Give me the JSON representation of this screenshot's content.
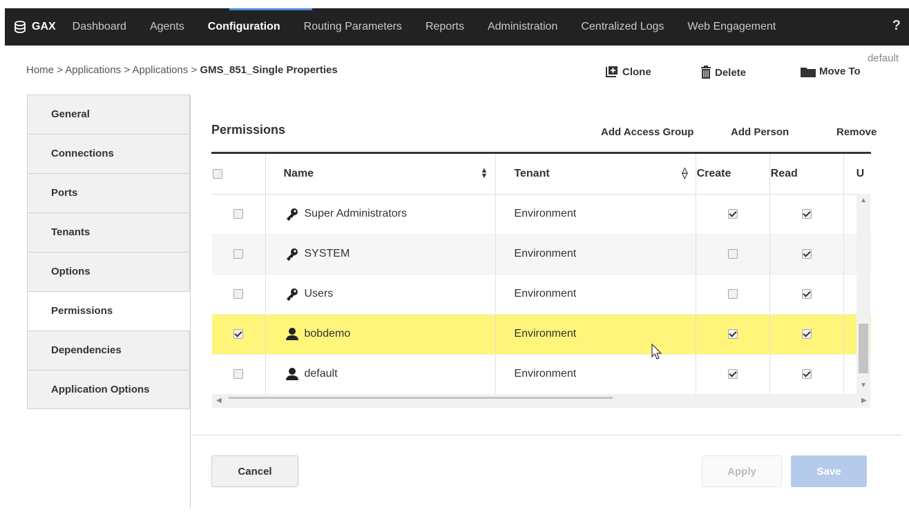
{
  "topbar": {
    "brand": "GAX",
    "nav": [
      "Dashboard",
      "Agents",
      "Configuration",
      "Routing Parameters",
      "Reports",
      "Administration",
      "Centralized Logs",
      "Web Engagement"
    ],
    "help": "?"
  },
  "breadcrumb": {
    "home": "Home",
    "sep": ">",
    "apps1": "Applications",
    "apps2": "Applications",
    "current": "GMS_851_Single Properties"
  },
  "toolbar": {
    "clone": "Clone",
    "delete": "Delete",
    "move_to": "Move To",
    "tag": "default"
  },
  "left_nav": [
    "General",
    "Connections",
    "Ports",
    "Tenants",
    "Options",
    "Permissions",
    "Dependencies",
    "Application Options"
  ],
  "permissions": {
    "title": "Permissions",
    "add_access_group": "Add Access Group",
    "add_person": "Add Person",
    "remove": "Remove",
    "columns": {
      "name": "Name",
      "tenant": "Tenant",
      "create": "Create",
      "read": "Read",
      "update": "U"
    },
    "rows": [
      {
        "name": "Super Administrators",
        "tenant": "Environment",
        "icon": "key-icon",
        "selected": false,
        "create": true,
        "read": true
      },
      {
        "name": "SYSTEM",
        "tenant": "Environment",
        "icon": "key-icon",
        "selected": false,
        "create": false,
        "read": true
      },
      {
        "name": "Users",
        "tenant": "Environment",
        "icon": "key-icon",
        "selected": false,
        "create": false,
        "read": true
      },
      {
        "name": "bobdemo",
        "tenant": "Environment",
        "icon": "person-icon",
        "selected": true,
        "create": true,
        "read": true
      },
      {
        "name": "default",
        "tenant": "Environment",
        "icon": "person-icon",
        "selected": false,
        "create": true,
        "read": true
      }
    ]
  },
  "buttons": {
    "cancel": "Cancel",
    "apply": "Apply",
    "save": "Save"
  },
  "colors": {
    "topbar": "#222222",
    "highlight": "#fff57a",
    "save_button": "#b6cbec"
  }
}
